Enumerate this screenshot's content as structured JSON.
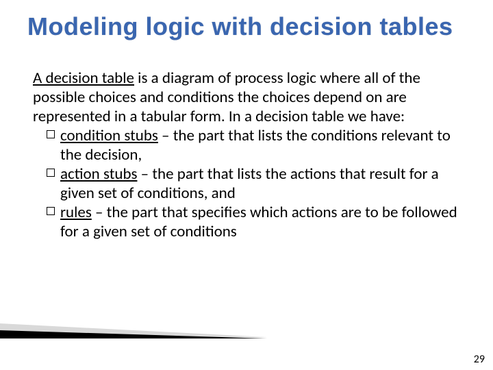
{
  "title": "Modeling logic with decision tables",
  "intro": {
    "lead_underlined": "A decision table",
    "lead_rest": " is a diagram of process logic where all of the possible choices and conditions the choices depend on are represented in a tabular form. In a decision table we have:"
  },
  "bullets": [
    {
      "term": "condition stubs",
      "rest": " – the part that lists the conditions relevant to the decision,"
    },
    {
      "term": "action stubs",
      "rest": " – the part that lists the actions that result for a given set of conditions, and"
    },
    {
      "term": "rules",
      "rest": " – the part that specifies which actions are to be followed for a given set of conditions"
    }
  ],
  "page_number": "29"
}
